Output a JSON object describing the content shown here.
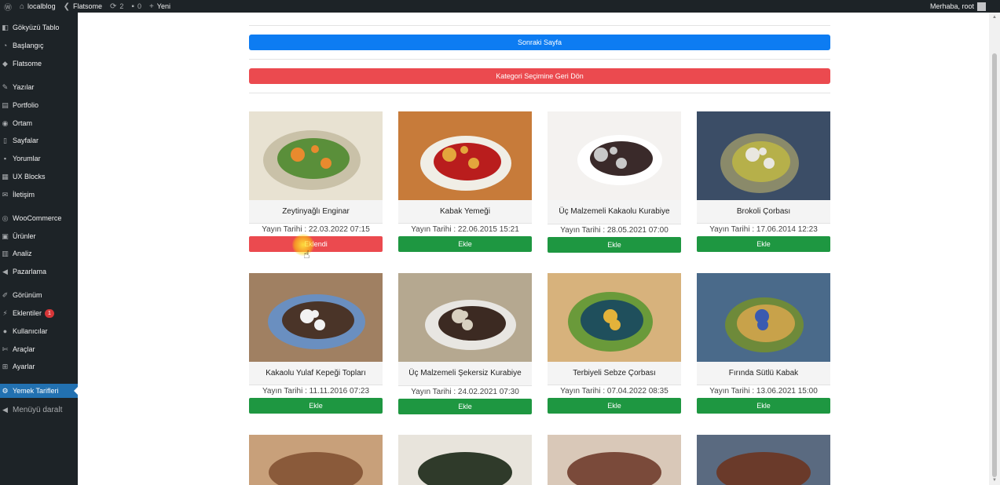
{
  "adminbar": {
    "site_name": "localblog",
    "theme": "Flatsome",
    "updates_count": "2",
    "comments_count": "0",
    "new_label": "Yeni",
    "greeting": "Merhaba, root"
  },
  "sidebar": {
    "items": [
      {
        "label": "Gökyüzü Tablo",
        "icon": "dashboard-icon"
      },
      {
        "label": "Başlangıç",
        "icon": "gauge-icon"
      },
      {
        "label": "Flatsome",
        "icon": "diamond-icon"
      },
      {
        "label": "Yazılar",
        "icon": "pin-icon"
      },
      {
        "label": "Portfolio",
        "icon": "portfolio-icon"
      },
      {
        "label": "Ortam",
        "icon": "media-icon"
      },
      {
        "label": "Sayfalar",
        "icon": "page-icon"
      },
      {
        "label": "Yorumlar",
        "icon": "comment-icon"
      },
      {
        "label": "UX Blocks",
        "icon": "blocks-icon"
      },
      {
        "label": "İletişim",
        "icon": "mail-icon"
      },
      {
        "label": "WooCommerce",
        "icon": "woo-icon"
      },
      {
        "label": "Ürünler",
        "icon": "products-icon"
      },
      {
        "label": "Analiz",
        "icon": "chart-icon"
      },
      {
        "label": "Pazarlama",
        "icon": "megaphone-icon"
      },
      {
        "label": "Görünüm",
        "icon": "brush-icon"
      },
      {
        "label": "Eklentiler",
        "icon": "plugin-icon",
        "badge": "1"
      },
      {
        "label": "Kullanıcılar",
        "icon": "users-icon"
      },
      {
        "label": "Araçlar",
        "icon": "wrench-icon"
      },
      {
        "label": "Ayarlar",
        "icon": "settings-icon"
      },
      {
        "label": "Yemek Tarifleri",
        "icon": "gear-icon",
        "active": true
      }
    ],
    "collapse_label": "Menüyü daralt"
  },
  "main": {
    "next_page_label": "Sonraki Sayfa",
    "back_label": "Kategori Seçimine Geri Dön",
    "date_prefix": "Yayın Tarihi : ",
    "recipes": [
      {
        "title": "Zeytinyağlı Enginar",
        "date": "22.03.2022 07:15",
        "button": "Eklendi",
        "added": true
      },
      {
        "title": "Kabak Yemeği",
        "date": "22.06.2015 15:21",
        "button": "Ekle",
        "added": false
      },
      {
        "title": "Üç Malzemeli Kakaolu Kurabiye",
        "date": "28.05.2021 07:00",
        "button": "Ekle",
        "added": false
      },
      {
        "title": "Brokoli Çorbası",
        "date": "17.06.2014 12:23",
        "button": "Ekle",
        "added": false
      },
      {
        "title": "Kakaolu Yulaf Kepeği Topları",
        "date": "11.11.2016 07:23",
        "button": "Ekle",
        "added": false
      },
      {
        "title": "Üç Malzemeli Şekersiz Kurabiye",
        "date": "24.02.2021 07:30",
        "button": "Ekle",
        "added": false
      },
      {
        "title": "Terbiyeli Sebze Çorbası",
        "date": "07.04.2022 08:35",
        "button": "Ekle",
        "added": false
      },
      {
        "title": "Fırında Sütlü Kabak",
        "date": "13.06.2021 15:00",
        "button": "Ekle",
        "added": false
      }
    ],
    "colors": {
      "blue": "#0d7cf2",
      "red": "#eb4a4f",
      "green": "#1e9741",
      "admin_dark": "#1d2327",
      "admin_active": "#2271b1"
    }
  }
}
